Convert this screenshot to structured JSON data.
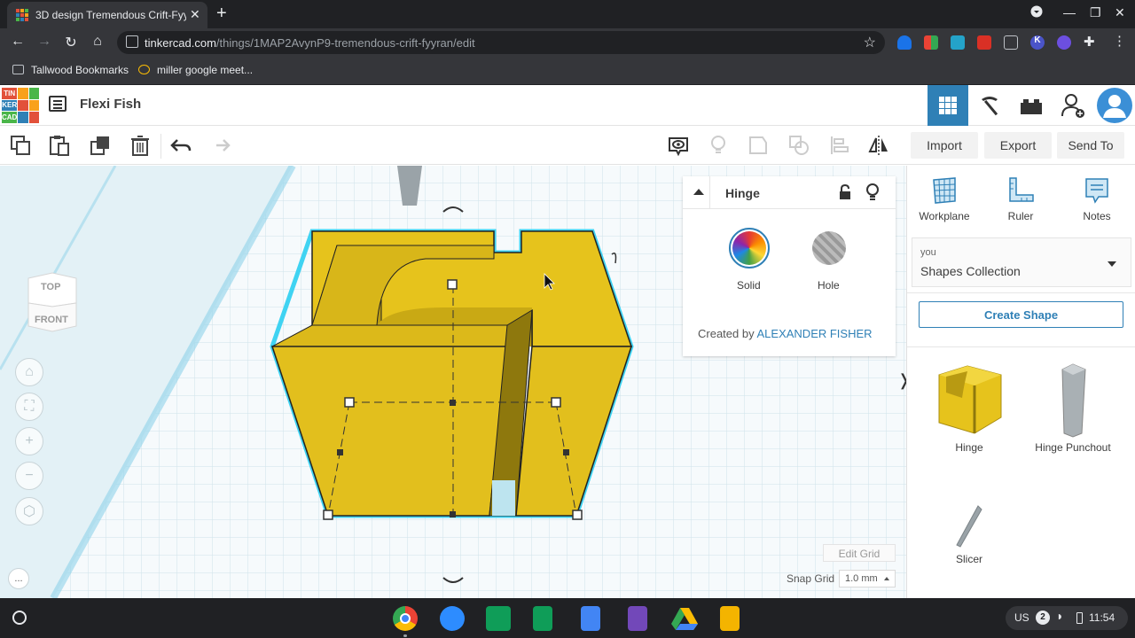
{
  "browser": {
    "tab_title": "3D design Tremendous Crift-Fyy",
    "url_host": "tinkercad.com",
    "url_path": "/things/1MAP2AvynP9-tremendous-crift-fyyran/edit",
    "bookmarks": [
      "Tallwood Bookmarks",
      "miller google meet..."
    ]
  },
  "app": {
    "logo_letters": [
      "TIN",
      "KER",
      "CAD"
    ],
    "design_title": "Flexi Fish",
    "toolbar": {
      "import": "Import",
      "export": "Export",
      "send_to": "Send To"
    },
    "right_tools": {
      "workplane": "Workplane",
      "ruler": "Ruler",
      "notes": "Notes"
    },
    "shapes_dropdown": {
      "owner": "you",
      "collection": "Shapes Collection"
    },
    "create_shape": "Create Shape",
    "shapes": [
      {
        "label": "Hinge"
      },
      {
        "label": "Hinge Punchout"
      },
      {
        "label": "Slicer"
      }
    ],
    "inspector": {
      "title": "Hinge",
      "solid": "Solid",
      "hole": "Hole",
      "created_by_prefix": "Created by",
      "created_by_name": "ALEXANDER FISHER"
    },
    "viewcube": {
      "top": "TOP",
      "front": "FRONT"
    },
    "edit_grid": "Edit Grid",
    "snap_grid_label": "Snap Grid",
    "snap_grid_value": "1.0 mm",
    "more_label": "..."
  },
  "shelf": {
    "locale": "US",
    "notification_count": "2",
    "time": "11:54"
  },
  "colors": {
    "accent": "#2f80b6",
    "shape_yellow": "#e6c31c",
    "outline_cyan": "#3fd3f2"
  }
}
